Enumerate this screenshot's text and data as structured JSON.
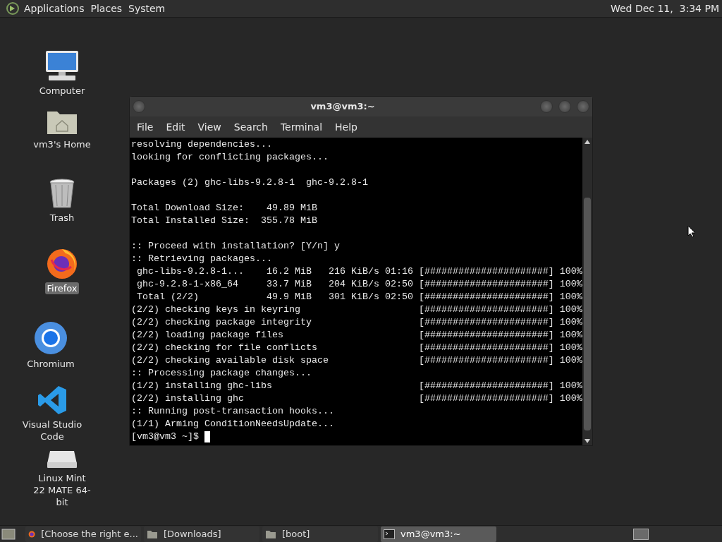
{
  "top_panel": {
    "menus": [
      "Applications",
      "Places",
      "System"
    ],
    "clock": "Wed Dec 11,  3:34 PM"
  },
  "desktop_icons": [
    {
      "kind": "computer",
      "label": "Computer",
      "selected": false
    },
    {
      "kind": "home",
      "label": "vm3's Home",
      "selected": false
    },
    {
      "kind": "trash",
      "label": "Trash",
      "selected": false
    },
    {
      "kind": "firefox",
      "label": "Firefox",
      "selected": true
    },
    {
      "kind": "chromium",
      "label": "Chromium",
      "selected": false
    },
    {
      "kind": "vscode",
      "label": "Visual Studio Code",
      "selected": false
    },
    {
      "kind": "drive",
      "label": "Linux Mint 22 MATE 64-bit",
      "selected": false
    }
  ],
  "terminal": {
    "title": "vm3@vm3:~",
    "menu": [
      "File",
      "Edit",
      "View",
      "Search",
      "Terminal",
      "Help"
    ],
    "lines": [
      {
        "kind": "text",
        "text": "resolving dependencies..."
      },
      {
        "kind": "text",
        "text": "looking for conflicting packages..."
      },
      {
        "kind": "blank"
      },
      {
        "kind": "text",
        "text": "Packages (2) ghc-libs-9.2.8-1  ghc-9.2.8-1"
      },
      {
        "kind": "blank"
      },
      {
        "kind": "text",
        "text": "Total Download Size:    49.89 MiB"
      },
      {
        "kind": "text",
        "text": "Total Installed Size:  355.78 MiB"
      },
      {
        "kind": "blank"
      },
      {
        "kind": "text",
        "text": ":: Proceed with installation? [Y/n] y"
      },
      {
        "kind": "text",
        "text": ":: Retrieving packages..."
      },
      {
        "kind": "progress",
        "text": " ghc-libs-9.2.8-1...    16.2 MiB   216 KiB/s 01:16",
        "bar": "[######################] 100%"
      },
      {
        "kind": "progress",
        "text": " ghc-9.2.8-1-x86_64     33.7 MiB   204 KiB/s 02:50",
        "bar": "[######################] 100%"
      },
      {
        "kind": "progress",
        "text": " Total (2/2)            49.9 MiB   301 KiB/s 02:50",
        "bar": "[######################] 100%"
      },
      {
        "kind": "progress",
        "text": "(2/2) checking keys in keyring",
        "bar": "[######################] 100%"
      },
      {
        "kind": "progress",
        "text": "(2/2) checking package integrity",
        "bar": "[######################] 100%"
      },
      {
        "kind": "progress",
        "text": "(2/2) loading package files",
        "bar": "[######################] 100%"
      },
      {
        "kind": "progress",
        "text": "(2/2) checking for file conflicts",
        "bar": "[######################] 100%"
      },
      {
        "kind": "progress",
        "text": "(2/2) checking available disk space",
        "bar": "[######################] 100%"
      },
      {
        "kind": "text",
        "text": ":: Processing package changes..."
      },
      {
        "kind": "progress",
        "text": "(1/2) installing ghc-libs",
        "bar": "[######################] 100%"
      },
      {
        "kind": "progress",
        "text": "(2/2) installing ghc",
        "bar": "[######################] 100%"
      },
      {
        "kind": "text",
        "text": ":: Running post-transaction hooks..."
      },
      {
        "kind": "text",
        "text": "(1/1) Arming ConditionNeedsUpdate..."
      }
    ],
    "prompt": "[vm3@vm3 ~]$"
  },
  "taskbar": {
    "items": [
      {
        "kind": "browser",
        "label": "[Choose the right e...",
        "selected": false
      },
      {
        "kind": "folder",
        "label": "[Downloads]",
        "selected": false
      },
      {
        "kind": "folder",
        "label": "[boot]",
        "selected": false
      },
      {
        "kind": "terminal",
        "label": "vm3@vm3:~",
        "selected": true
      }
    ]
  }
}
